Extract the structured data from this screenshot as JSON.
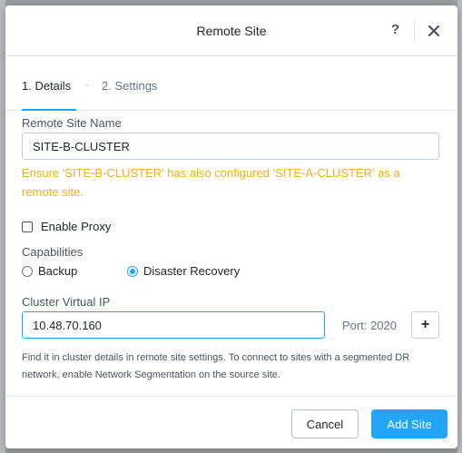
{
  "modal": {
    "title": "Remote Site",
    "help_glyph": "?",
    "help_icon": "question-icon",
    "close_icon": "close-icon"
  },
  "tabs": [
    {
      "label": "1. Details",
      "active": true
    },
    {
      "label": "2. Settings",
      "active": false
    }
  ],
  "tab_separator": "·",
  "remote_site_name": {
    "label": "Remote Site Name",
    "value": "SITE-B-CLUSTER"
  },
  "warning": "Ensure 'SITE-B-CLUSTER' has also configured 'SITE-A-CLUSTER' as a remote site.",
  "enable_proxy": {
    "label": "Enable Proxy",
    "checked": false
  },
  "capabilities": {
    "label": "Capabilities",
    "options": [
      {
        "label": "Backup",
        "selected": false
      },
      {
        "label": "Disaster Recovery",
        "selected": true
      }
    ]
  },
  "cluster_vip": {
    "label": "Cluster Virtual IP",
    "value": "10.48.70.160",
    "port_label": "Port: 2020",
    "add_glyph": "+",
    "add_icon": "plus-icon"
  },
  "hint": "Find it in cluster details in remote site settings. To connect to sites with a segmented DR network, enable Network Segmentation on the source site.",
  "footer": {
    "cancel_label": "Cancel",
    "add_label": "Add Site"
  },
  "colors": {
    "accent": "#22a5f7",
    "warning": "#f0ad1e"
  }
}
